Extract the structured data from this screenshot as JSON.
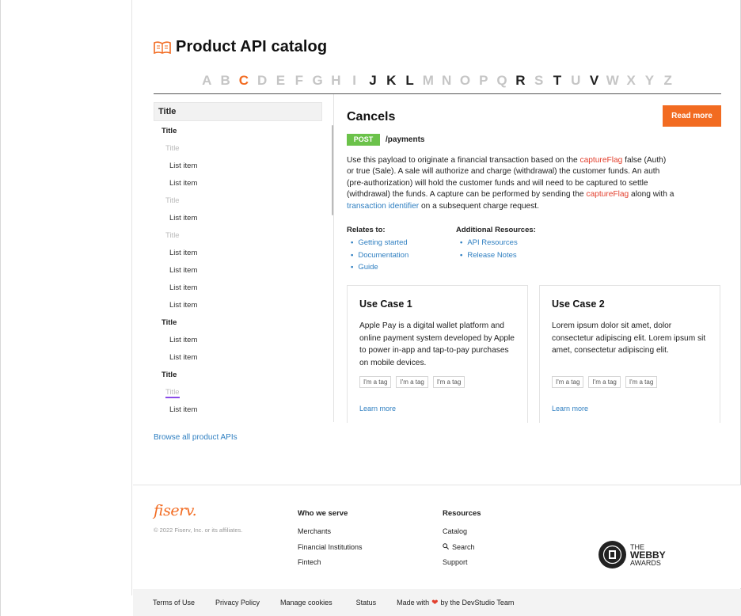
{
  "page": {
    "title": "Product API catalog"
  },
  "alphabet": {
    "letters": [
      "A",
      "B",
      "C",
      "D",
      "E",
      "F",
      "G",
      "H",
      "I",
      "J",
      "K",
      "L",
      "M",
      "N",
      "O",
      "P",
      "Q",
      "R",
      "S",
      "T",
      "U",
      "V",
      "W",
      "X",
      "Y",
      "Z"
    ],
    "selected": "C",
    "active": [
      "J",
      "K",
      "L",
      "R",
      "T",
      "V"
    ]
  },
  "sidebar": {
    "header": "Title",
    "items": [
      {
        "label": "Title",
        "kind": "t1"
      },
      {
        "label": "Title",
        "kind": "t2"
      },
      {
        "label": "List item",
        "kind": "li"
      },
      {
        "label": "List item",
        "kind": "li"
      },
      {
        "label": "Title",
        "kind": "t2"
      },
      {
        "label": "List item",
        "kind": "li"
      },
      {
        "label": "Title",
        "kind": "t2"
      },
      {
        "label": "List item",
        "kind": "li"
      },
      {
        "label": "List item",
        "kind": "li"
      },
      {
        "label": "List item",
        "kind": "li"
      },
      {
        "label": "List item",
        "kind": "li"
      },
      {
        "label": "Title",
        "kind": "t1"
      },
      {
        "label": "List item",
        "kind": "li"
      },
      {
        "label": "List item",
        "kind": "li"
      },
      {
        "label": "Title",
        "kind": "t1"
      },
      {
        "label": "Title",
        "kind": "t2 active"
      },
      {
        "label": "List item",
        "kind": "li"
      }
    ]
  },
  "content": {
    "title": "Cancels",
    "read_more": "Read more",
    "method": "POST",
    "endpoint": "/payments",
    "desc": {
      "p1": "Use this payload to originate a financial transaction based on the ",
      "link1": "captureFlag",
      "p2": " false (Auth) or true (Sale). A sale will authorize and charge (withdrawal) the customer funds. An auth (pre-authorization) will hold the customer funds and will need to be captured to settle (withdrawal) the funds. A capture can be performed by sending the ",
      "link2": "captureFlag",
      "p3": " along with a ",
      "link3": "transaction identifier",
      "p4": " on a subsequent charge request."
    },
    "relates": {
      "heading": "Relates to:",
      "links": [
        "Getting started",
        "Documentation",
        "Guide"
      ]
    },
    "resources": {
      "heading": "Additional Resources:",
      "links": [
        "API Resources",
        "Release Notes"
      ]
    },
    "cards": [
      {
        "title": "Use Case 1",
        "text": "Apple Pay is a digital wallet platform and online payment system developed by Apple to power in-app and tap-to-pay purchases on mobile devices.",
        "tags": [
          "I'm a tag",
          "I'm a tag",
          "I'm a tag"
        ],
        "link": "Learn more"
      },
      {
        "title": "Use Case 2",
        "text": "Lorem ipsum dolor sit amet, dolor consectetur adipiscing elit. Lorem ipsum sit amet, consectetur adipiscing elit.",
        "tags": [
          "I'm a tag",
          "I'm a tag",
          "I'm a tag"
        ],
        "link": "Learn more"
      }
    ],
    "browse": "Browse all product APIs"
  },
  "footer": {
    "brand": "fiserv.",
    "copyright": "© 2022 Fiserv, Inc. or its affiliates.",
    "who": {
      "heading": "Who we serve",
      "links": [
        "Merchants",
        "Financial Institutions",
        "Fintech"
      ]
    },
    "resources": {
      "heading": "Resources",
      "links": [
        "Catalog",
        "Search",
        "Support"
      ]
    },
    "webby": {
      "line1": "THE",
      "line2": "WEBBY",
      "line3": "AWARDS"
    },
    "bottom": {
      "terms": "Terms of Use",
      "privacy": "Privacy Policy",
      "cookies": "Manage cookies",
      "status": "Status",
      "made_pre": "Made with",
      "made_post": "by the DevStudio Team"
    }
  },
  "colors": {
    "accent": "#f26b21",
    "link": "#2f7fc1",
    "post": "#6bc24a",
    "flag": "#e2402e"
  }
}
